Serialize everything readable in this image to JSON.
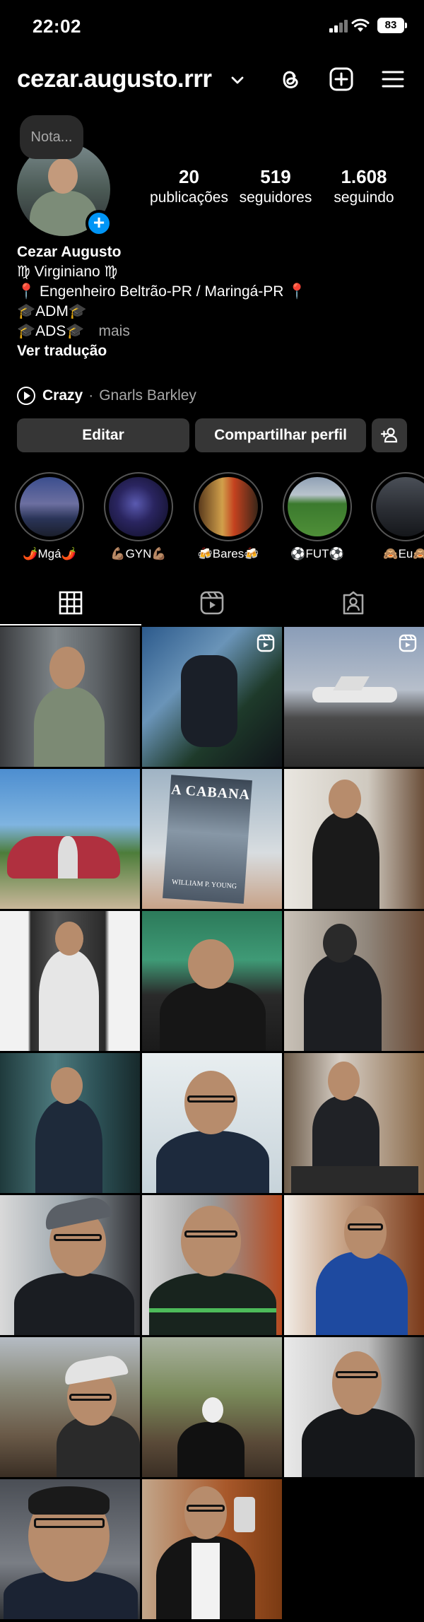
{
  "status_bar": {
    "time": "22:02",
    "battery": "83"
  },
  "header": {
    "username": "cezar.augusto.rrr"
  },
  "profile": {
    "note_placeholder": "Nota...",
    "stats": [
      {
        "value": "20",
        "label": "publicações"
      },
      {
        "value": "519",
        "label": "seguidores"
      },
      {
        "value": "1.608",
        "label": "seguindo"
      }
    ],
    "name": "Cezar Augusto",
    "bio_lines": [
      "♍ Virginiano ♍",
      "📍 Engenheiro Beltrão-PR / Maringá-PR 📍",
      "🎓ADM🎓",
      "🎓ADS🎓"
    ],
    "more_label": "mais",
    "translate_label": "Ver tradução",
    "music": {
      "song": "Crazy",
      "separator": "·",
      "artist": "Gnarls Barkley"
    }
  },
  "actions": {
    "edit_label": "Editar",
    "share_label": "Compartilhar perfil"
  },
  "highlights": [
    {
      "label": "🌶️Mgá🌶️"
    },
    {
      "label": "💪🏽GYN💪🏽"
    },
    {
      "label": "🍻Bares🍻"
    },
    {
      "label": "⚽FUT⚽"
    },
    {
      "label": "🙈Eu🙈"
    }
  ],
  "tabs": [
    "grid-icon",
    "reels-icon",
    "tagged-icon"
  ],
  "posts": [
    {
      "type": "photo"
    },
    {
      "type": "reel"
    },
    {
      "type": "reel"
    },
    {
      "type": "photo"
    },
    {
      "type": "photo"
    },
    {
      "type": "photo"
    },
    {
      "type": "photo"
    },
    {
      "type": "photo"
    },
    {
      "type": "photo"
    },
    {
      "type": "photo"
    },
    {
      "type": "photo"
    },
    {
      "type": "photo"
    },
    {
      "type": "photo"
    },
    {
      "type": "photo"
    },
    {
      "type": "photo"
    },
    {
      "type": "photo"
    },
    {
      "type": "photo"
    },
    {
      "type": "photo"
    },
    {
      "type": "photo"
    },
    {
      "type": "photo"
    }
  ],
  "book_cover": {
    "title": "A CABANA",
    "author": "WILLIAM P. YOUNG"
  },
  "colors": {
    "background": "#000000",
    "button": "#363636",
    "accent": "#0095f6",
    "muted": "#a8a8a8"
  }
}
